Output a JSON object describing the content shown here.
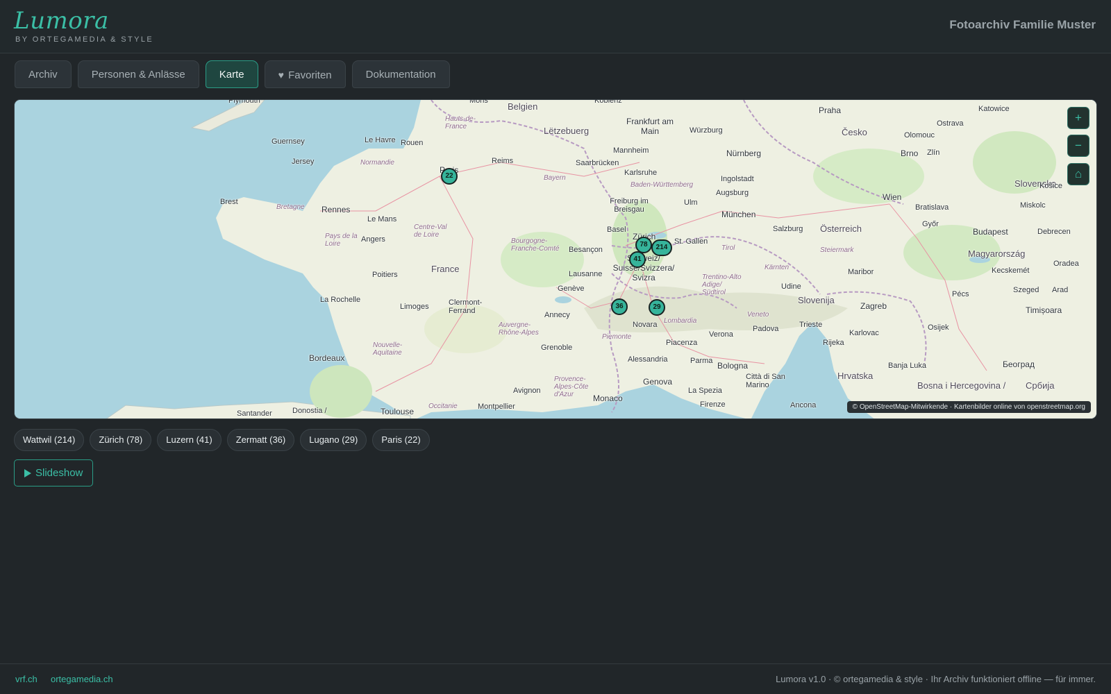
{
  "app": {
    "logo": "Lumora",
    "logo_sub": "BY ORTEGAMEDIA & STYLE",
    "title": "Fotoarchiv Familie Muster",
    "accent_color": "#3bbfa6"
  },
  "tabs": [
    {
      "label": "Archiv",
      "active": false
    },
    {
      "label": "Personen & Anlässe",
      "active": false
    },
    {
      "label": "Karte",
      "active": true
    },
    {
      "label": "Favoriten",
      "icon": "heart-icon",
      "active": false
    },
    {
      "label": "Dokumentation",
      "active": false
    }
  ],
  "map": {
    "controls": {
      "zoom_in": "+",
      "zoom_out": "−",
      "home": "⌂"
    },
    "attribution": "© OpenStreetMap-Mitwirkende · Kartenbilder online von openstreetmap.org",
    "markers": [
      {
        "count": "214",
        "place": "Wattwil"
      },
      {
        "count": "78",
        "place": "Zürich"
      },
      {
        "count": "41",
        "place": "Luzern"
      },
      {
        "count": "36",
        "place": "Zermatt"
      },
      {
        "count": "29",
        "place": "Lugano"
      },
      {
        "count": "22",
        "place": "Paris"
      }
    ],
    "labels": {
      "belgien": "Belgien",
      "letzebuerg": "Lëtzebuerg",
      "frankfurt": "Frankfurt am Main",
      "praha": "Praha",
      "cesko": "Česko",
      "nurnberg": "Nürnberg",
      "mannheim": "Mannheim",
      "karlsruhe": "Karlsruhe",
      "saarbrucken": "Saarbrücken",
      "reims": "Reims",
      "rouen": "Rouen",
      "lehavre": "Le Havre",
      "guernsey": "Guernsey",
      "jersey": "Jersey",
      "normandie": "Normandie",
      "paris": "Paris",
      "rennes": "Rennes",
      "brest": "Brest",
      "bretagne": "Bretagne",
      "lemans": "Le Mans",
      "angers": "Angers",
      "paysdelaloire": "Pays de la Loire",
      "centre": "Centre-Val de Loire",
      "france": "France",
      "poitiers": "Poitiers",
      "larochelle": "La Rochelle",
      "limoges": "Limoges",
      "clermont": "Clermont-Ferrand",
      "bordeaux": "Bordeaux",
      "nouvelle": "Nouvelle-Aquitaine",
      "toulouse": "Toulouse",
      "montpellier": "Montpellier",
      "avignon": "Avignon",
      "grenoble": "Grenoble",
      "lyon": "Auvergne-Rhône-Alpes",
      "bourgogne": "Bourgogne-Franche-Comté",
      "besancon": "Besançon",
      "basel": "Basel",
      "freiburg": "Freiburg im Breisgau",
      "stuttgart": "Baden-Württemberg",
      "munchen": "München",
      "augsburg": "Augsburg",
      "ulm": "Ulm",
      "bayern": "Bayern",
      "zurich": "Zürich",
      "stgallen": "St. Gallen",
      "schweiz": "Schweiz/ Suisse/Svizzera/ Svizra",
      "lausanne": "Lausanne",
      "geneve": "Genève",
      "annecy": "Annecy",
      "piemonte": "Piemonte",
      "novara": "Novara",
      "lombardia": "Lombardia",
      "piacenza": "Piacenza",
      "alessandria": "Alessandria",
      "genova": "Genova",
      "monaco": "Monaco",
      "laspezia": "La Spezia",
      "parma": "Parma",
      "bologna": "Bologna",
      "verona": "Verona",
      "padova": "Padova",
      "veneto": "Veneto",
      "trento": "Trentino-Alto Adige/ Südtirol",
      "udine": "Udine",
      "trieste": "Trieste",
      "slovenija": "Slovenija",
      "zagreb": "Zagreb",
      "rijeka": "Rijeka",
      "karlovac": "Karlovac",
      "hrvatska": "Hrvatska",
      "bosna": "Bosna i Hercegovina /",
      "banjaluka": "Banja Luka",
      "osterreich": "Österreich",
      "salzburg": "Salzburg",
      "wien": "Wien",
      "bratislava": "Bratislava",
      "brno": "Brno",
      "zlin": "Zlín",
      "slovensko": "Slovensko",
      "budapest": "Budapest",
      "magyarorszag": "Magyarország",
      "szeged": "Szeged",
      "pecs": "Pécs",
      "osijek": "Osijek",
      "timisoara": "Timișoara",
      "arad": "Arad",
      "beograd": "Београд",
      "srbija": "Србија",
      "katowice": "Katowice",
      "ostrava": "Ostrava",
      "olomouc": "Olomouc",
      "kosice": "Košice",
      "miskolc": "Miskolc",
      "debrecen": "Debrecen",
      "oradea": "Oradea",
      "kecskemet": "Kecskemét",
      "gyor": "Győr",
      "maribor": "Maribor",
      "graz": "Steiermark",
      "karnten": "Kärnten",
      "tirol": "Tirol",
      "ingolstadt": "Ingolstadt",
      "wurzburg": "Würzburg",
      "koblenz": "Koblenz",
      "mons": "Mons",
      "haut": "Hauts-de-France",
      "firenze": "Firenze",
      "cittasanmarino": "Città di San Marino",
      "ancona": "Ancona",
      "provence": "Provence-Alpes-Côte d'Azur",
      "occitanie": "Occitanie",
      "plymouth": "Plymouth",
      "santander": "Santander",
      "donostia": "Donostia /"
    }
  },
  "chips": [
    "Wattwil (214)",
    "Zürich (78)",
    "Luzern (41)",
    "Zermatt (36)",
    "Lugano (29)",
    "Paris (22)"
  ],
  "slideshow_label": "Slideshow",
  "footer": {
    "link1": "vrf.ch",
    "link2": "ortegamedia.ch",
    "text": "Lumora v1.0 · © ortegamedia & style · Ihr Archiv funktioniert offline — für immer."
  }
}
